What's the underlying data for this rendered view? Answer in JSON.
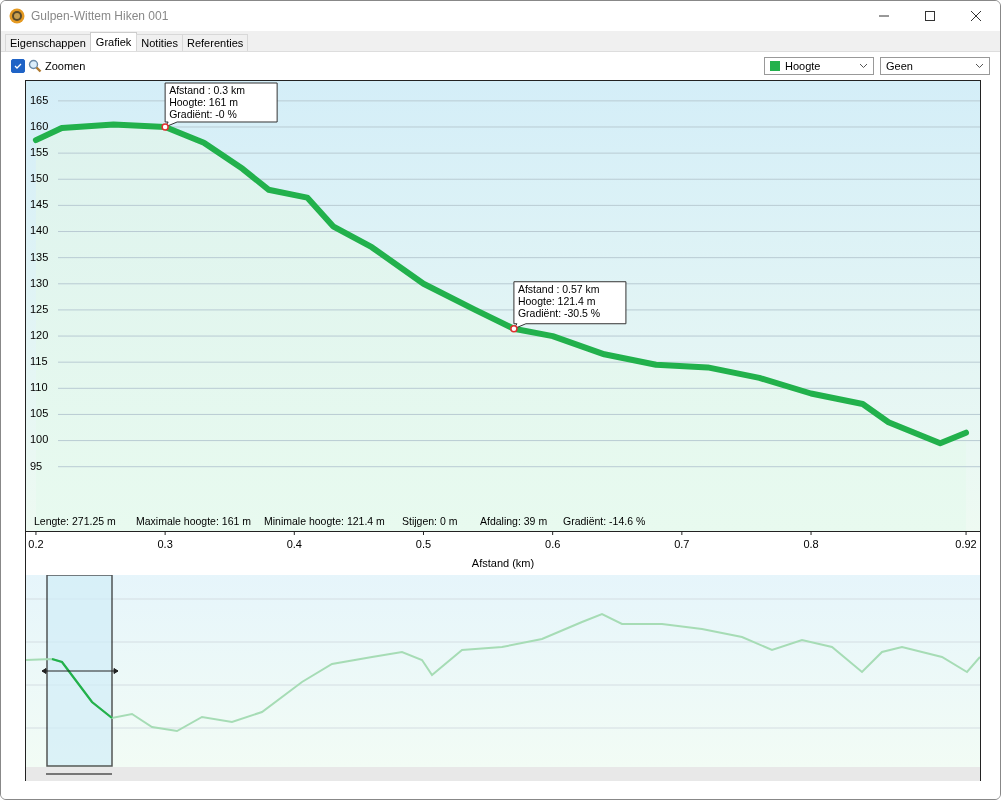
{
  "window": {
    "title": "Gulpen-Wittem Hiken 001"
  },
  "tabs": [
    {
      "label": "Eigenschappen",
      "selected": false
    },
    {
      "label": "Grafiek",
      "selected": true
    },
    {
      "label": "Notities",
      "selected": false
    },
    {
      "label": "Referenties",
      "selected": false
    }
  ],
  "toolbar": {
    "zoom": {
      "label": "Zoomen",
      "checked": true
    },
    "second_dropdown": {
      "value": "Geen"
    }
  },
  "chart": {
    "stats": [
      "Lengte: 271.25 m",
      "Maximale hoogte: 161 m",
      "Minimale hoogte: 121.4 m",
      "Stijgen: 0 m",
      "Afdaling: 39 m",
      "Gradiënt: -14.6 %"
    ],
    "chart_data": {
      "type": "area",
      "grid": true,
      "xlabel": "Afstand  (km)",
      "x": [
        0.2,
        0.22,
        0.26,
        0.3,
        0.33,
        0.36,
        0.38,
        0.41,
        0.43,
        0.46,
        0.5,
        0.54,
        0.57,
        0.6,
        0.64,
        0.68,
        0.72,
        0.76,
        0.8,
        0.84,
        0.86,
        0.9,
        0.92
      ],
      "series": [
        {
          "name": "Hoogte",
          "color": "#22b14c",
          "values": [
            157.5,
            159.8,
            160.5,
            160,
            157,
            152,
            148,
            146.5,
            141,
            137,
            130,
            125,
            121.4,
            120,
            116.5,
            114.5,
            114,
            112,
            109,
            107,
            103.5,
            99.5,
            101.5
          ]
        }
      ],
      "xlim": [
        0.1923,
        0.9308
      ],
      "ylim": [
        82.7,
        168.8
      ],
      "xticks": [
        0.2,
        0.3,
        0.4,
        0.5,
        0.6,
        0.7,
        0.8,
        0.92
      ],
      "yticks": [
        95,
        100,
        105,
        110,
        115,
        120,
        125,
        130,
        135,
        140,
        145,
        150,
        155,
        160,
        165
      ],
      "annotations": [
        {
          "x": 0.3,
          "y": 160,
          "text": "Afstand  : 0.3 km\nHoogte: 161 m\nGradiënt: -0 %"
        },
        {
          "x": 0.57,
          "y": 121.4,
          "text": "Afstand  : 0.57 km\nHoogte: 121.4 m\nGradiënt: -30.5 %"
        }
      ]
    }
  }
}
